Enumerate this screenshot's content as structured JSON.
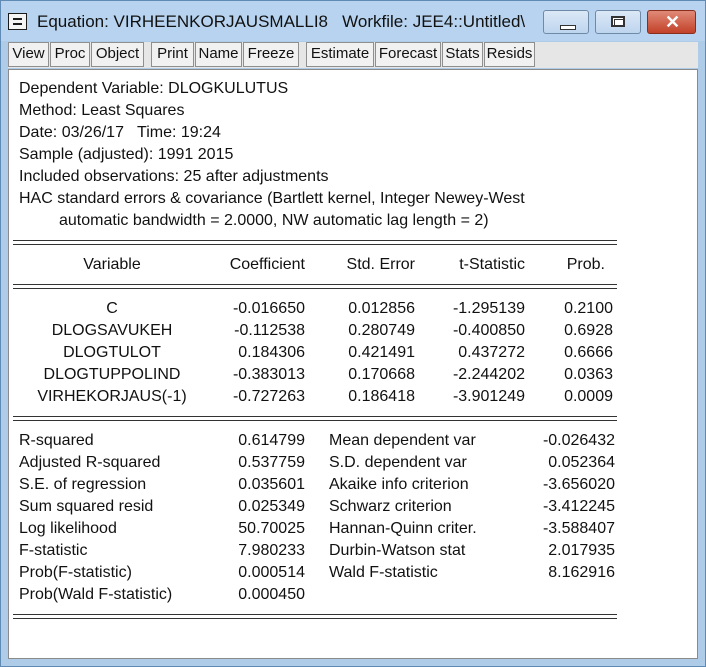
{
  "window": {
    "title": "Equation: VIRHEENKORJAUSMALLI8   Workfile: JEE4::Untitled\\"
  },
  "toolbar": {
    "buttons": [
      "View",
      "Proc",
      "Object",
      "Print",
      "Name",
      "Freeze",
      "Estimate",
      "Forecast",
      "Stats",
      "Resids"
    ]
  },
  "header": {
    "lines": [
      "Dependent Variable: DLOGKULUTUS",
      "Method: Least Squares",
      "Date: 03/26/17   Time: 19:24",
      "Sample (adjusted): 1991 2015",
      "Included observations: 25 after adjustments",
      "HAC standard errors & covariance (Bartlett kernel, Integer Newey-West",
      "automatic bandwidth = 2.0000, NW automatic lag length = 2)"
    ]
  },
  "coef_table": {
    "columns": [
      "Variable",
      "Coefficient",
      "Std. Error",
      "t-Statistic",
      "Prob."
    ],
    "rows": [
      [
        "C",
        "-0.016650",
        "0.012856",
        "-1.295139",
        "0.2100"
      ],
      [
        "DLOGSAVUKEH",
        "-0.112538",
        "0.280749",
        "-0.400850",
        "0.6928"
      ],
      [
        "DLOGTULOT",
        "0.184306",
        "0.421491",
        "0.437272",
        "0.6666"
      ],
      [
        "DLOGTUPPOLIND",
        "-0.383013",
        "0.170668",
        "-2.244202",
        "0.0363"
      ],
      [
        "VIRHEKORJAUS(-1)",
        "-0.727263",
        "0.186418",
        "-3.901249",
        "0.0009"
      ]
    ]
  },
  "stats": {
    "left": [
      [
        "R-squared",
        "0.614799"
      ],
      [
        "Adjusted R-squared",
        "0.537759"
      ],
      [
        "S.E. of regression",
        "0.035601"
      ],
      [
        "Sum squared resid",
        "0.025349"
      ],
      [
        "Log likelihood",
        "50.70025"
      ],
      [
        "F-statistic",
        "7.980233"
      ],
      [
        "Prob(F-statistic)",
        "0.000514"
      ],
      [
        "Prob(Wald F-statistic)",
        "0.000450"
      ]
    ],
    "right": [
      [
        "Mean dependent var",
        "-0.026432"
      ],
      [
        "S.D. dependent var",
        "0.052364"
      ],
      [
        "Akaike info criterion",
        "-3.656020"
      ],
      [
        "Schwarz criterion",
        "-3.412245"
      ],
      [
        "Hannan-Quinn criter.",
        "-3.588407"
      ],
      [
        "Durbin-Watson stat",
        "2.017935"
      ],
      [
        "Wald F-statistic",
        "8.162916"
      ]
    ]
  }
}
